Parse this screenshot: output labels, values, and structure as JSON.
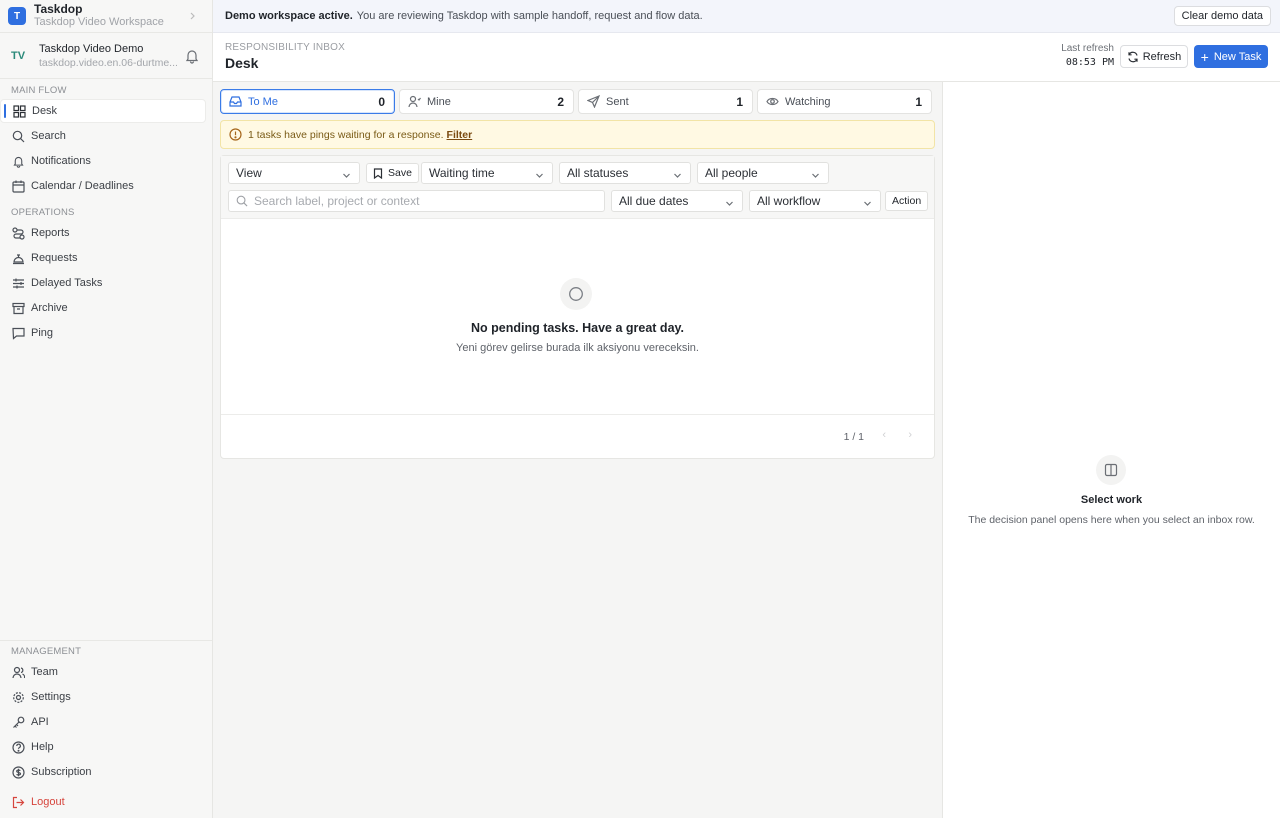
{
  "workspace": {
    "logo_letter": "T",
    "name": "Taskdop",
    "subtitle": "Taskdop Video Workspace"
  },
  "account": {
    "initials": "TV",
    "name": "Taskdop Video Demo",
    "email": "taskdop.video.en.06-durtme..."
  },
  "sidebar": {
    "main_flow_label": "MAIN FLOW",
    "main_flow": [
      {
        "label": "Desk",
        "icon": "grid-icon",
        "active": true
      },
      {
        "label": "Search",
        "icon": "search-icon"
      },
      {
        "label": "Notifications",
        "icon": "bell-icon"
      },
      {
        "label": "Calendar / Deadlines",
        "icon": "calendar-icon"
      }
    ],
    "operations_label": "OPERATIONS",
    "operations": [
      {
        "label": "Reports",
        "icon": "route-icon"
      },
      {
        "label": "Requests",
        "icon": "concierge-icon"
      },
      {
        "label": "Delayed Tasks",
        "icon": "sliders-icon"
      },
      {
        "label": "Archive",
        "icon": "archive-icon"
      },
      {
        "label": "Ping",
        "icon": "chat-icon"
      }
    ],
    "management_label": "MANAGEMENT",
    "management": [
      {
        "label": "Team",
        "icon": "users-icon"
      },
      {
        "label": "Settings",
        "icon": "gear-icon"
      },
      {
        "label": "API",
        "icon": "key-icon"
      },
      {
        "label": "Help",
        "icon": "help-icon"
      },
      {
        "label": "Subscription",
        "icon": "dollar-icon"
      }
    ],
    "logout_label": "Logout"
  },
  "banner": {
    "bold": "Demo workspace active.",
    "text": "You are reviewing Taskdop with sample handoff, request and flow data.",
    "clear_label": "Clear demo data"
  },
  "header": {
    "eyebrow": "RESPONSIBILITY INBOX",
    "title": "Desk",
    "last_refresh_label": "Last refresh",
    "last_refresh_time": "08:53 PM",
    "refresh_label": "Refresh",
    "new_task_label": "New Task"
  },
  "tabs": [
    {
      "label": "To Me",
      "count": "0",
      "icon": "inbox-icon",
      "active": true
    },
    {
      "label": "Mine",
      "count": "2",
      "icon": "user-icon"
    },
    {
      "label": "Sent",
      "count": "1",
      "icon": "send-icon"
    },
    {
      "label": "Watching",
      "count": "1",
      "icon": "eye-icon"
    }
  ],
  "alert": {
    "text": "1 tasks have pings waiting for a response.",
    "link": "Filter"
  },
  "filters": {
    "view": "View",
    "save": "Save",
    "sort": "Waiting time",
    "status": "All statuses",
    "people": "All people",
    "search_placeholder": "Search label, project or context",
    "due": "All due dates",
    "workflow": "All workflow",
    "action": "Action"
  },
  "empty": {
    "title": "No pending tasks. Have a great day.",
    "subtitle": "Yeni görev gelirse burada ilk aksiyonu vereceksin."
  },
  "pager": {
    "page": "1 / 1",
    "prev": "‹",
    "next": "›"
  },
  "detail": {
    "title": "Select work",
    "subtitle": "The decision panel opens here when you select an inbox row."
  },
  "colors": {
    "accent": "#2f6fe0",
    "alert_bg": "#fff9e3",
    "logout": "#d6453d"
  }
}
